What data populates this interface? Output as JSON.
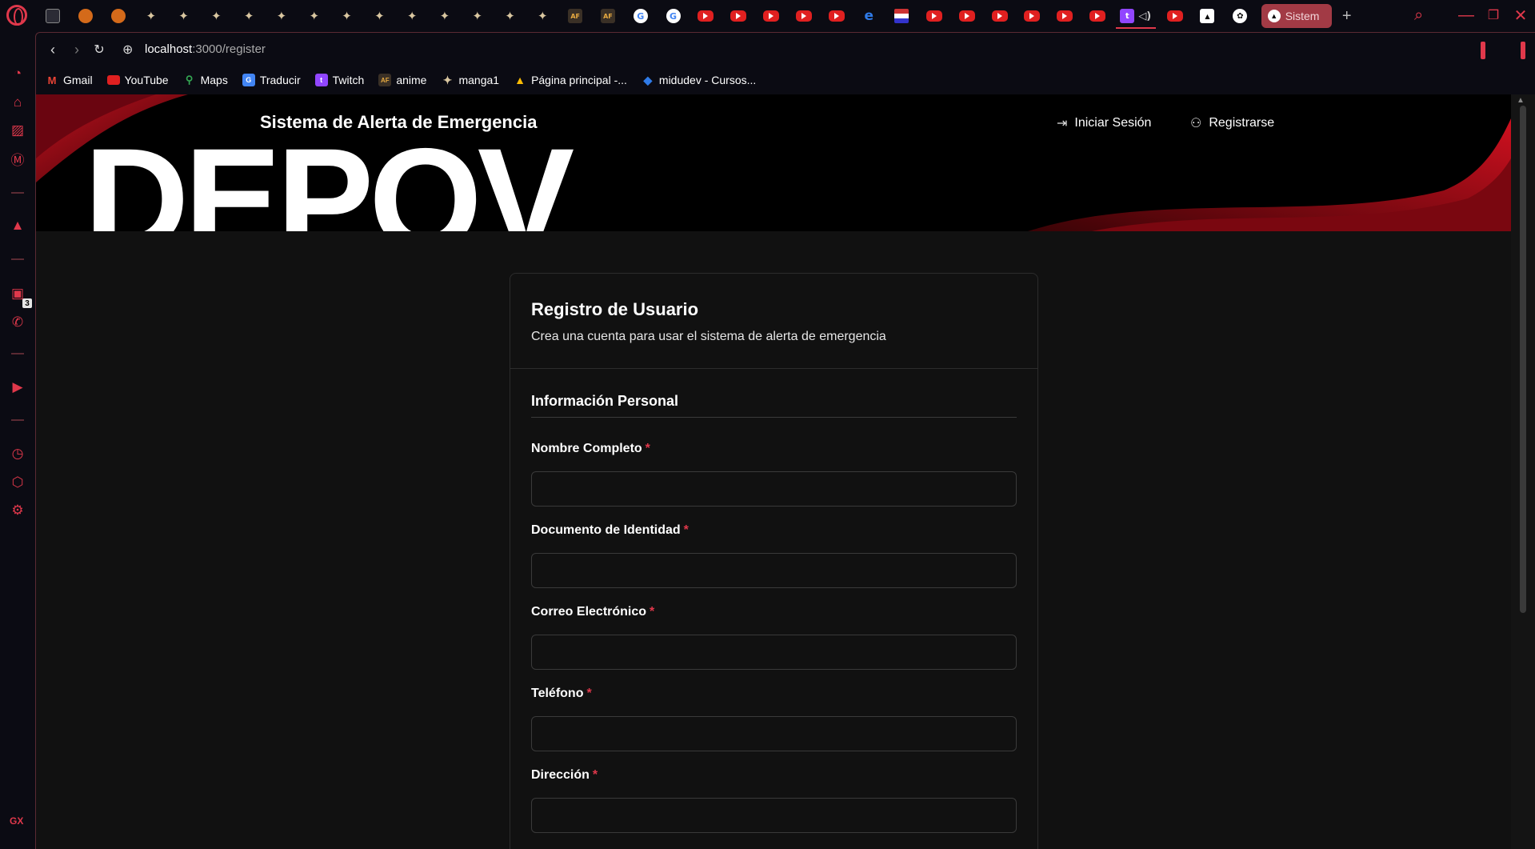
{
  "browser": {
    "current_tab_title": "Sistem",
    "url_host": "localhost",
    "url_path": ":3000/register",
    "bookmarks": [
      {
        "label": "Gmail",
        "icon": "gmail-icon"
      },
      {
        "label": "YouTube",
        "icon": "youtube-icon"
      },
      {
        "label": "Maps",
        "icon": "maps-icon"
      },
      {
        "label": "Traducir",
        "icon": "translate-icon"
      },
      {
        "label": "Twitch",
        "icon": "twitch-icon"
      },
      {
        "label": "anime",
        "icon": "af-icon"
      },
      {
        "label": "manga1",
        "icon": "cat-icon"
      },
      {
        "label": "Página principal -...",
        "icon": "drive-icon"
      },
      {
        "label": "midudev - Cursos...",
        "icon": "midudev-icon"
      }
    ],
    "sidebar_badge": "3",
    "sidebar_footer": "GX",
    "accent_color": "#e0384b"
  },
  "header": {
    "subtitle": "Sistema de Alerta de Emergencia",
    "logo": "DEPOV",
    "login_label": "Iniciar Sesión",
    "register_label": "Registrarse"
  },
  "form": {
    "title": "Registro de Usuario",
    "description": "Crea una cuenta para usar el sistema de alerta de emergencia",
    "section_title": "Información Personal",
    "required_mark": "*",
    "fields": [
      {
        "label": "Nombre Completo",
        "value": ""
      },
      {
        "label": "Documento de Identidad",
        "value": ""
      },
      {
        "label": "Correo Electrónico",
        "value": ""
      },
      {
        "label": "Teléfono",
        "value": ""
      },
      {
        "label": "Dirección",
        "value": ""
      }
    ]
  }
}
